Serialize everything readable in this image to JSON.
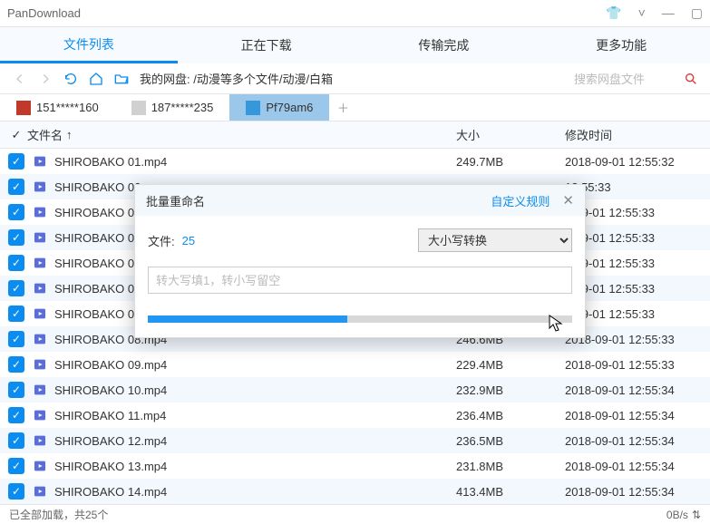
{
  "app": {
    "title": "PanDownload"
  },
  "tabs": [
    {
      "label": "文件列表",
      "active": true
    },
    {
      "label": "正在下载",
      "active": false
    },
    {
      "label": "传输完成",
      "active": false
    },
    {
      "label": "更多功能",
      "active": false
    }
  ],
  "breadcrumb": "我的网盘: /动漫等多个文件/动漫/白箱",
  "search_placeholder": "搜索网盘文件",
  "accounts": [
    {
      "name": "151*****160",
      "active": false
    },
    {
      "name": "187*****235",
      "active": false
    },
    {
      "name": "Pf79am6",
      "active": true
    }
  ],
  "columns": {
    "name": "文件名",
    "sort_arrow": "↑",
    "size": "大小",
    "date": "修改时间"
  },
  "files": [
    {
      "name": "SHIROBAKO 01.mp4",
      "size": "249.7MB",
      "date": "2018-09-01 12:55:32"
    },
    {
      "name": "SHIROBAKO 02",
      "size": "",
      "date": "12:55:33"
    },
    {
      "name": "SHIROBAKO 03",
      "size": "",
      "date": "8-09-01 12:55:33"
    },
    {
      "name": "SHIROBAKO 04",
      "size": "",
      "date": "8-09-01 12:55:33"
    },
    {
      "name": "SHIROBAKO 05",
      "size": "",
      "date": "8-09-01 12:55:33"
    },
    {
      "name": "SHIROBAKO 06",
      "size": "",
      "date": "8-09-01 12:55:33"
    },
    {
      "name": "SHIROBAKO 07",
      "size": "",
      "date": "8-09-01 12:55:33"
    },
    {
      "name": "SHIROBAKO 08.mp4",
      "size": "246.6MB",
      "date": "2018-09-01 12:55:33"
    },
    {
      "name": "SHIROBAKO 09.mp4",
      "size": "229.4MB",
      "date": "2018-09-01 12:55:33"
    },
    {
      "name": "SHIROBAKO 10.mp4",
      "size": "232.9MB",
      "date": "2018-09-01 12:55:34"
    },
    {
      "name": "SHIROBAKO 11.mp4",
      "size": "236.4MB",
      "date": "2018-09-01 12:55:34"
    },
    {
      "name": "SHIROBAKO 12.mp4",
      "size": "236.5MB",
      "date": "2018-09-01 12:55:34"
    },
    {
      "name": "SHIROBAKO 13.mp4",
      "size": "231.8MB",
      "date": "2018-09-01 12:55:34"
    },
    {
      "name": "SHIROBAKO 14.mp4",
      "size": "413.4MB",
      "date": "2018-09-01 12:55:34"
    }
  ],
  "modal": {
    "title": "批量重命名",
    "rule_link": "自定义规则",
    "file_label": "文件:",
    "file_count": "25",
    "select_value": "大小写转换",
    "input_placeholder": "转大写填1，转小写留空",
    "progress_percent": 47
  },
  "status": {
    "left": "已全部加载，共25个",
    "right": "0B/s"
  }
}
